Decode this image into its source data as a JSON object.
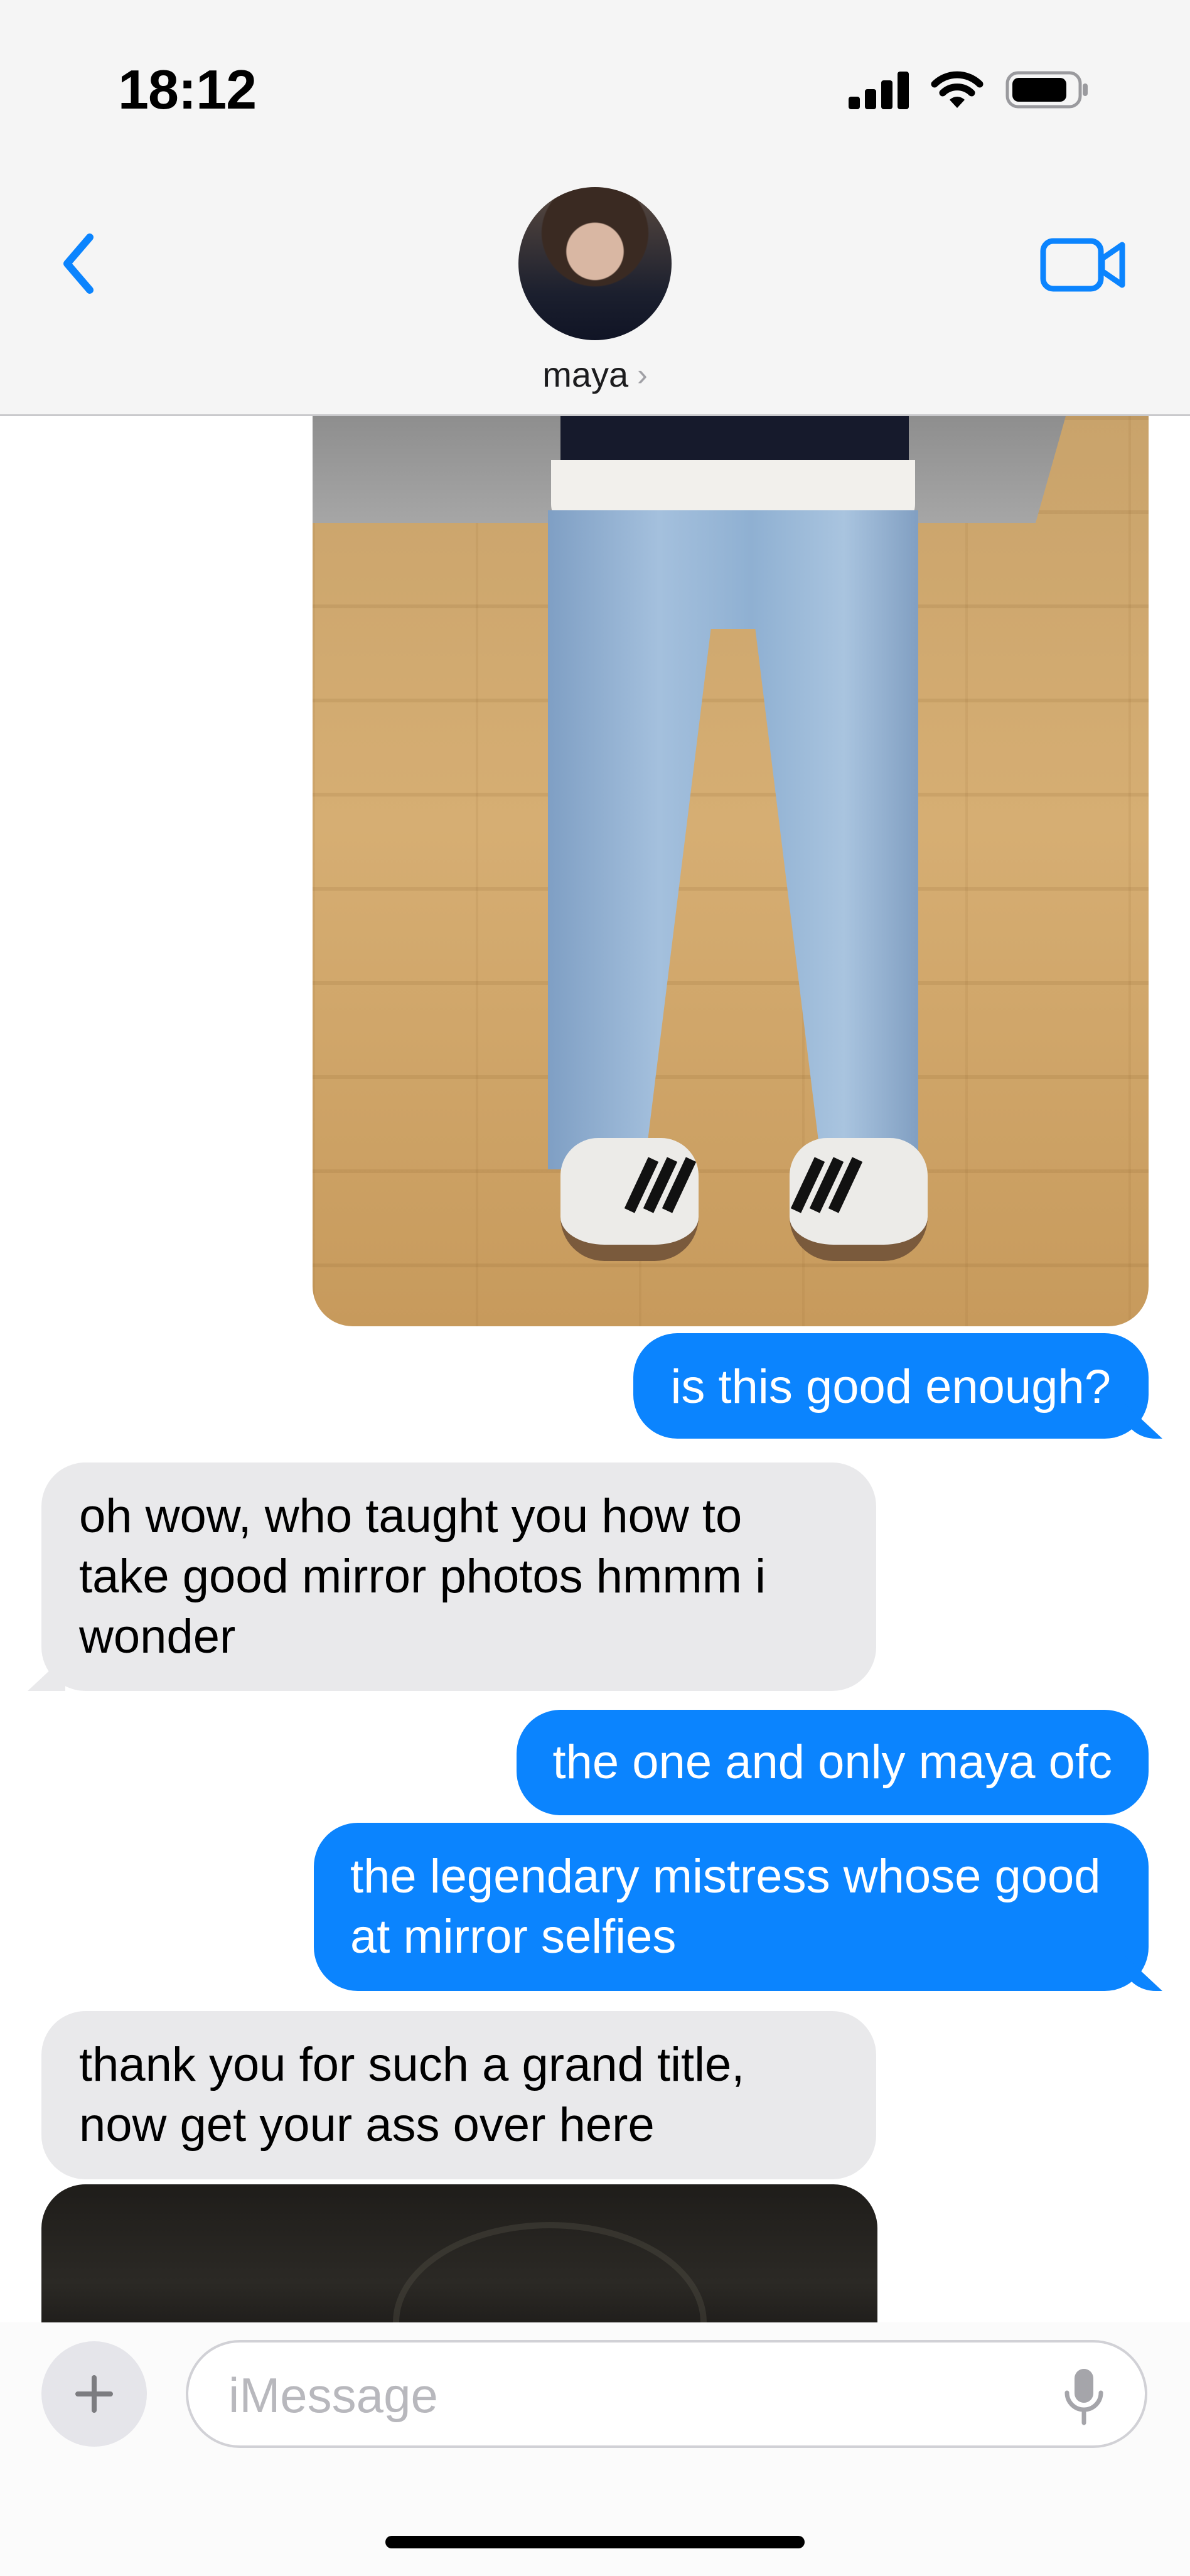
{
  "status_bar": {
    "time": "18:12",
    "icons": [
      "cellular-signal-icon",
      "wifi-icon",
      "battery-icon"
    ]
  },
  "header": {
    "back_icon": "chevron-left-icon",
    "contact_name": "maya",
    "name_chevron": "›",
    "video_icon": "video-camera-icon",
    "accent_color": "#0b84fe"
  },
  "messages": [
    {
      "type": "image",
      "direction": "sent",
      "description_icon": "photo"
    },
    {
      "type": "text",
      "direction": "sent",
      "text": "is this good enough?"
    },
    {
      "type": "text",
      "direction": "received",
      "text": "oh wow, who taught you how to take good mirror photos hmmm i wonder"
    },
    {
      "type": "text",
      "direction": "sent",
      "text": "the one and only maya ofc"
    },
    {
      "type": "text",
      "direction": "sent",
      "text": "the legendary mistress whose good at mirror selfies"
    },
    {
      "type": "text",
      "direction": "received",
      "text": "thank you for such a grand title, now get your ass over here"
    },
    {
      "type": "image",
      "direction": "received",
      "description_icon": "photo"
    }
  ],
  "composer": {
    "plus_label": "+",
    "placeholder": "iMessage",
    "value": "",
    "mic_icon": "microphone-icon"
  },
  "colors": {
    "sent_bubble": "#0b84fe",
    "received_bubble": "#e9e9eb",
    "header_bg": "#f5f5f5"
  }
}
